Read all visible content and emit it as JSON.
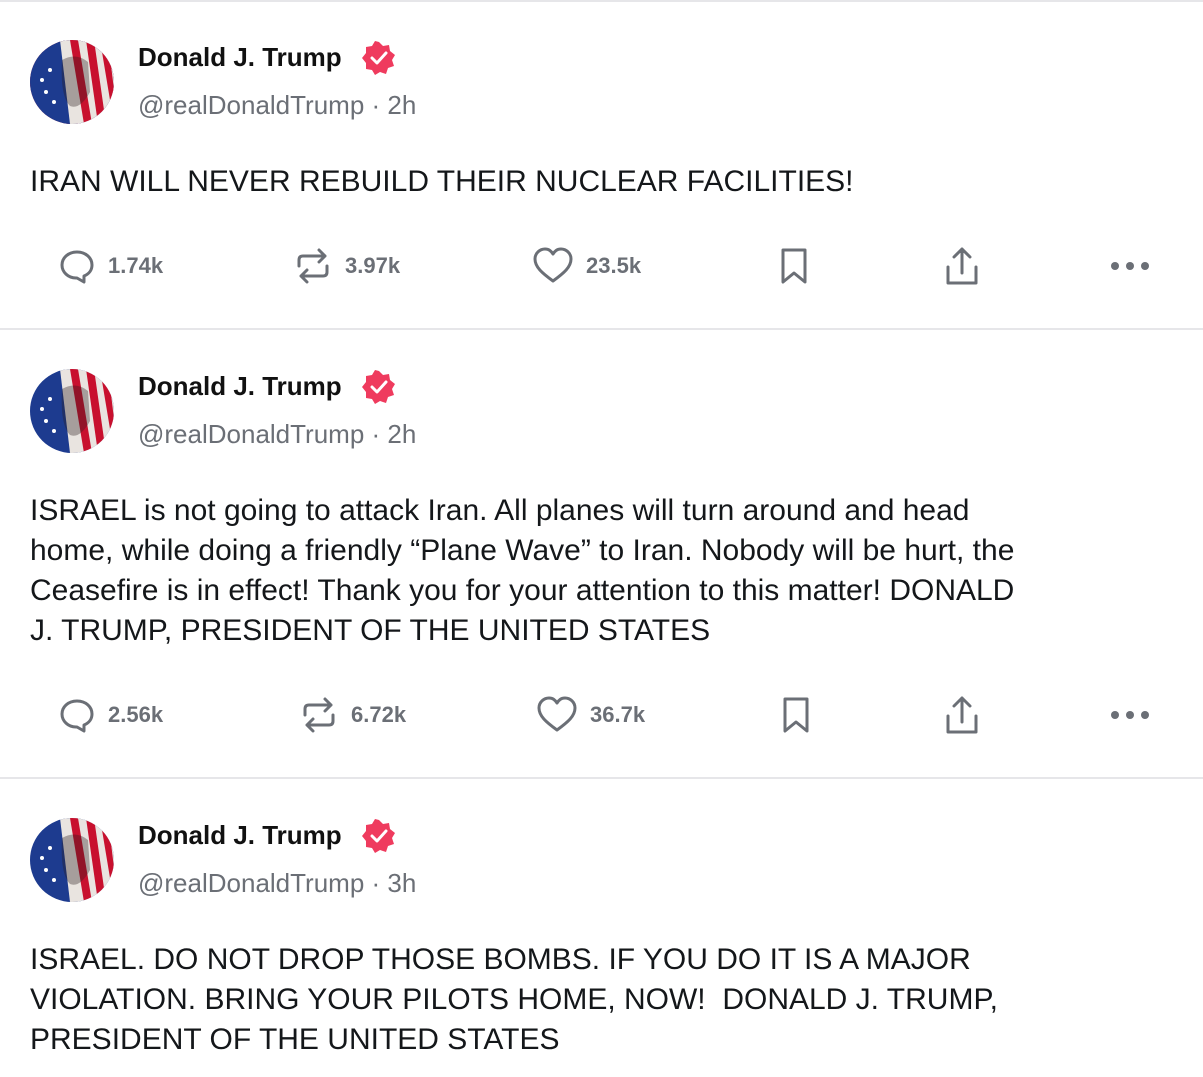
{
  "colors": {
    "accent": "#ef3b5e",
    "muted": "#6b6f76",
    "divider": "#e6e6e9"
  },
  "posts": [
    {
      "author": "Donald J. Trump",
      "handle_time": "@realDonaldTrump · 2h",
      "text": "IRAN WILL NEVER REBUILD THEIR NUCLEAR FACILITIES!",
      "replies": "1.74k",
      "reposts": "3.97k",
      "likes": "23.5k"
    },
    {
      "author": "Donald J. Trump",
      "handle_time": "@realDonaldTrump · 2h",
      "text": "ISRAEL is not going to attack Iran. All planes will turn around and head\nhome, while doing a friendly “Plane Wave” to Iran. Nobody will be hurt, the\nCeasefire is in effect! Thank you for your attention to this matter! DONALD\nJ. TRUMP, PRESIDENT OF THE UNITED STATES",
      "replies": "2.56k",
      "reposts": "6.72k",
      "likes": "36.7k"
    },
    {
      "author": "Donald J. Trump",
      "handle_time": "@realDonaldTrump · 3h",
      "text": "ISRAEL. DO NOT DROP THOSE BOMBS. IF YOU DO IT IS A MAJOR\nVIOLATION. BRING YOUR PILOTS HOME, NOW!  DONALD J. TRUMP,\nPRESIDENT OF THE UNITED STATES"
    }
  ],
  "icons": [
    "reply-icon",
    "repost-icon",
    "like-icon",
    "bookmark-icon",
    "share-icon",
    "more-icon",
    "verified-badge-icon"
  ]
}
